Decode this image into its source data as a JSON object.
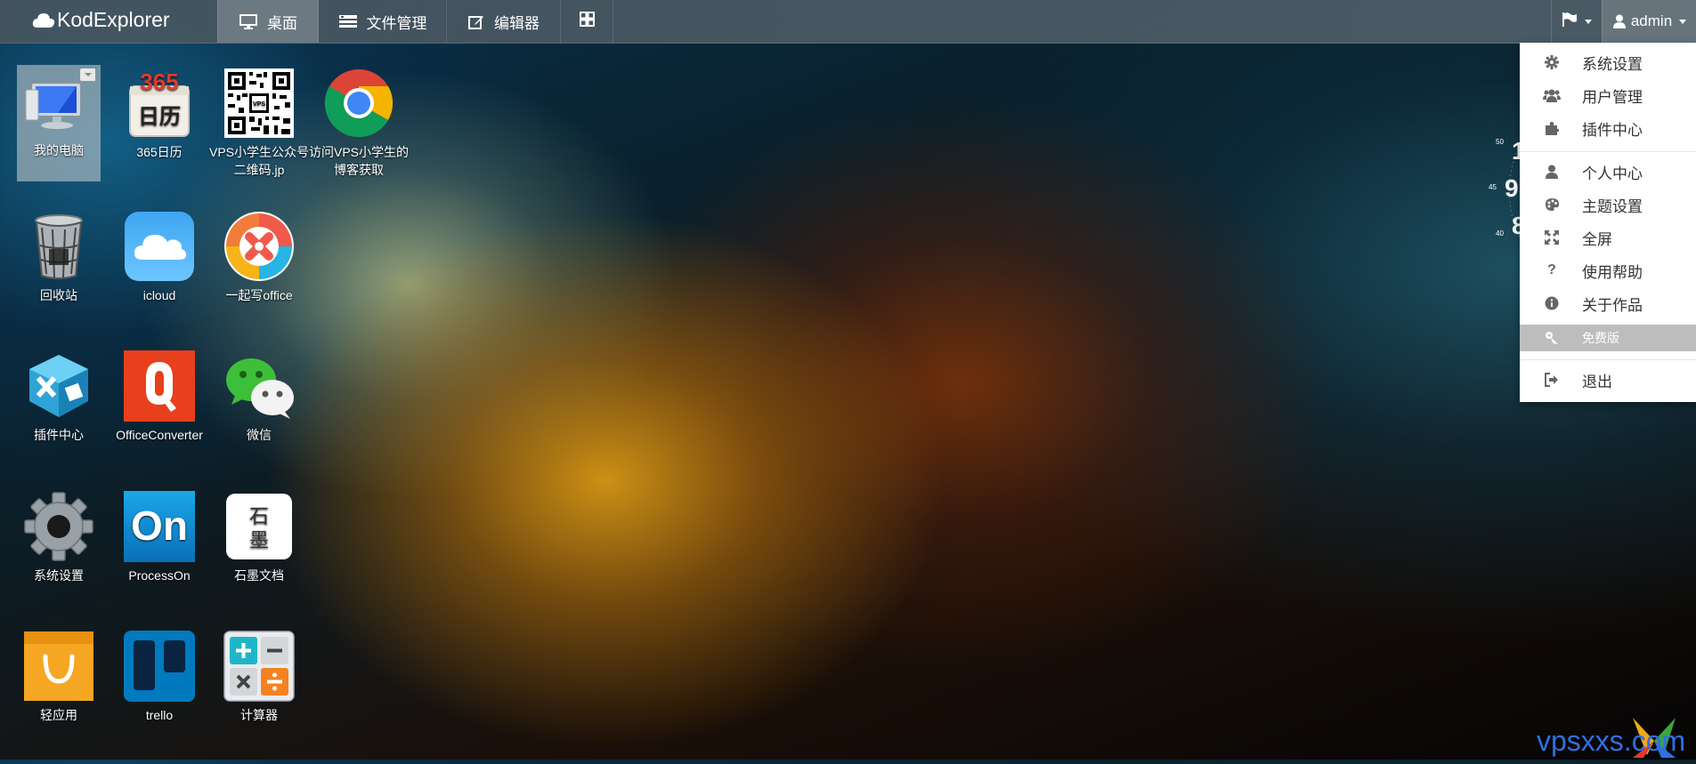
{
  "navbar": {
    "brand": "KodExplorer",
    "tabs": [
      {
        "label": "桌面",
        "active": true
      },
      {
        "label": "文件管理",
        "active": false
      },
      {
        "label": "编辑器",
        "active": false
      }
    ],
    "user": "admin"
  },
  "desktop": {
    "icons": [
      {
        "label": "我的电脑"
      },
      {
        "label": "365日历"
      },
      {
        "label": "VPS小学生公众号二维码.jp"
      },
      {
        "label": "访问VPS小学生的博客获取"
      },
      {
        "label": "回收站"
      },
      {
        "label": "icloud"
      },
      {
        "label": "一起写office"
      },
      {
        "label": "插件中心"
      },
      {
        "label": "OfficeConverter"
      },
      {
        "label": "微信"
      },
      {
        "label": "系统设置"
      },
      {
        "label": "ProcessOn"
      },
      {
        "label": "石墨文档"
      },
      {
        "label": "轻应用"
      },
      {
        "label": "trello"
      },
      {
        "label": "计算器"
      }
    ],
    "calendar_text": {
      "top": "365",
      "bottom": "日历"
    },
    "shimo_text": {
      "top": "石",
      "bottom": "墨"
    },
    "processon_text": "On"
  },
  "user_menu": {
    "items": [
      {
        "label": "系统设置",
        "icon": "gear-icon"
      },
      {
        "label": "用户管理",
        "icon": "users-icon"
      },
      {
        "label": "插件中心",
        "icon": "puzzle-icon"
      },
      {
        "label": "个人中心",
        "icon": "user-icon"
      },
      {
        "label": "主题设置",
        "icon": "palette-icon"
      },
      {
        "label": "全屏",
        "icon": "fullscreen-icon"
      },
      {
        "label": "使用帮助",
        "icon": "question-icon"
      },
      {
        "label": "关于作品",
        "icon": "info-icon"
      },
      {
        "label": "免费版",
        "icon": "key-icon"
      },
      {
        "label": "退出",
        "icon": "logout-icon"
      }
    ]
  },
  "clock_widget": {
    "ticks": [
      "50",
      "45",
      "40"
    ],
    "digits": [
      "1",
      "9",
      "8"
    ]
  },
  "watermark": "vpsxxs.com"
}
